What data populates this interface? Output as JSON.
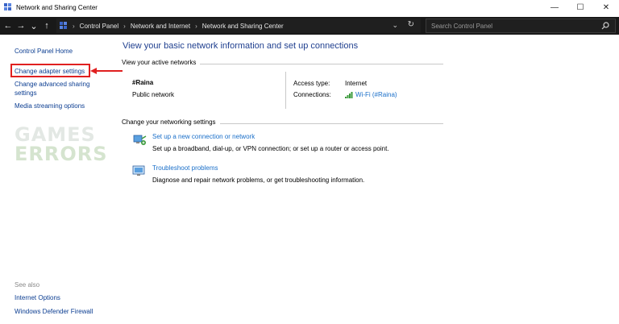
{
  "window": {
    "title": "Network and Sharing Center",
    "minimize_glyph": "—",
    "maximize_glyph": "☐",
    "close_glyph": "✕"
  },
  "addressbar": {
    "back_glyph": "←",
    "forward_glyph": "→",
    "recent_glyph": "⌄",
    "up_glyph": "↑",
    "breadcrumbs": [
      "Control Panel",
      "Network and Internet",
      "Network and Sharing Center"
    ],
    "separator": "›",
    "dropdown_glyph": "⌄",
    "refresh_glyph": "↻",
    "search_placeholder": "Search Control Panel"
  },
  "leftpane": {
    "links": [
      "Control Panel Home",
      "Change adapter settings",
      "Change advanced sharing settings",
      "Media streaming options"
    ],
    "see_also_label": "See also",
    "see_also_links": [
      "Internet Options",
      "Windows Defender Firewall"
    ]
  },
  "watermark": {
    "line1": "GAMES",
    "line2": "ERRORS"
  },
  "main": {
    "heading": "View your basic network information and set up connections",
    "active_networks_label": "View your active networks",
    "network": {
      "name": "#Raina",
      "type": "Public network",
      "access_type_label": "Access type:",
      "access_type_value": "Internet",
      "connections_label": "Connections:",
      "connections_value": "Wi-Fi (#Raina)"
    },
    "change_settings_label": "Change your networking settings",
    "tasks": [
      {
        "title": "Set up a new connection or network",
        "description": "Set up a broadband, dial-up, or VPN connection; or set up a router or access point.",
        "icon": "new-connection-icon"
      },
      {
        "title": "Troubleshoot problems",
        "description": "Diagnose and repair network problems, or get troubleshooting information.",
        "icon": "troubleshoot-icon"
      }
    ]
  },
  "colors": {
    "link": "#1a6fc9",
    "heading": "#1f3f8f",
    "highlight": "#e02020",
    "addressbar_bg": "#191919"
  }
}
